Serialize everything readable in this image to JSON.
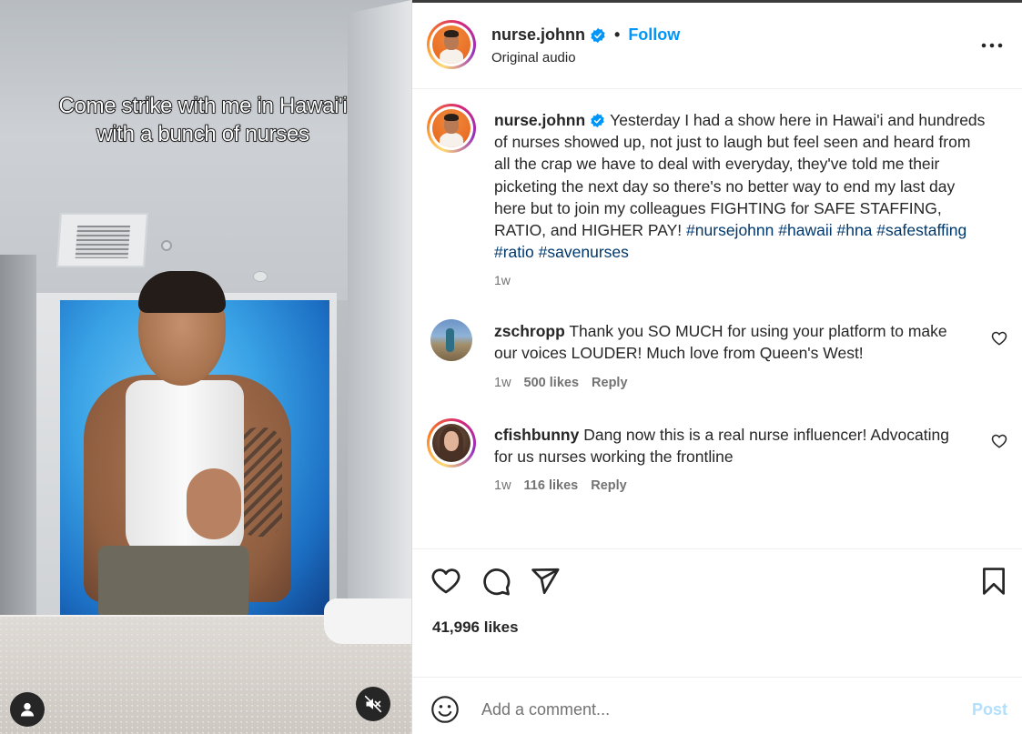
{
  "video": {
    "caption": "Come strike with me in Hawai'i with a bunch of nurses",
    "icons": {
      "user_tag": "user-tag-icon",
      "mute": "muted-speaker-icon"
    }
  },
  "post_header": {
    "username": "nurse.johnn",
    "verified": true,
    "separator": "•",
    "follow_label": "Follow",
    "audio_label": "Original audio"
  },
  "caption": {
    "username": "nurse.johnn",
    "text": "Yesterday I had a show here in Hawai'i and hundreds of nurses showed up, not just to laugh but feel seen and heard from all the crap we have to deal with everyday, they've told me their picketing the next day so there's no better way to end my last day here but to join my colleagues FIGHTING for SAFE STAFFING, RATIO, and HIGHER PAY!",
    "hashtags": [
      "#nursejohnn",
      "#hawaii",
      "#hna",
      "#safestaffing",
      "#ratio",
      "#savenurses"
    ],
    "time": "1w"
  },
  "comments": [
    {
      "username": "zschropp",
      "text": "Thank you SO MUCH for using your platform to make our voices LOUDER! Much love from Queen's West!",
      "time": "1w",
      "likes": "500 likes",
      "reply_label": "Reply"
    },
    {
      "username": "cfishbunny",
      "text": "Dang now this is a real nurse influencer! Advocating for us nurses working the frontline",
      "time": "1w",
      "likes": "116 likes",
      "reply_label": "Reply"
    }
  ],
  "actions": {
    "likes_count": "41,996 likes"
  },
  "comment_box": {
    "placeholder": "Add a comment...",
    "post_label": "Post"
  },
  "colors": {
    "link_blue": "#0095f6",
    "hashtag": "#00376b",
    "muted_text": "#737373",
    "post_disabled": "#b2dffc"
  }
}
